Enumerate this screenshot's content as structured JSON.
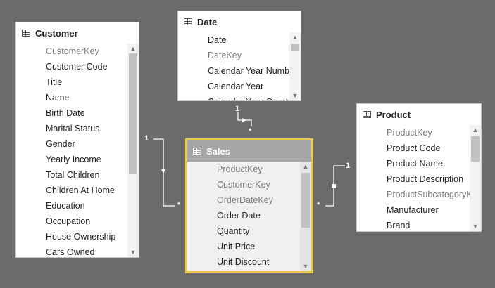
{
  "tables": {
    "customer": {
      "title": "Customer",
      "fields": [
        "CustomerKey",
        "Customer Code",
        "Title",
        "Name",
        "Birth Date",
        "Marital Status",
        "Gender",
        "Yearly Income",
        "Total Children",
        "Children At Home",
        "Education",
        "Occupation",
        "House Ownership",
        "Cars Owned"
      ],
      "key_fields": [
        0
      ]
    },
    "date": {
      "title": "Date",
      "fields": [
        "Date",
        "DateKey",
        "Calendar Year Numb",
        "Calendar Year",
        "Calendar Year Quart"
      ],
      "key_fields": [
        1
      ]
    },
    "sales": {
      "title": "Sales",
      "fields": [
        "ProductKey",
        "CustomerKey",
        "OrderDateKey",
        "Order Date",
        "Quantity",
        "Unit Price",
        "Unit Discount"
      ],
      "key_fields": [
        0,
        1,
        2
      ]
    },
    "product": {
      "title": "Product",
      "fields": [
        "ProductKey",
        "Product Code",
        "Product Name",
        "Product Description",
        "ProductSubcategoryKey",
        "Manufacturer",
        "Brand"
      ],
      "key_fields": [
        0,
        4
      ]
    }
  },
  "relationships": {
    "customer_sales": {
      "one": "1",
      "many": "*"
    },
    "date_sales": {
      "one": "1",
      "many": "*"
    },
    "product_sales": {
      "one": "1",
      "many": "*"
    }
  },
  "colors": {
    "canvas": "#6b6b6b",
    "selected_border": "#e8c94a",
    "selected_header": "#a6a6a6",
    "key_field_text": "#7a7a7a"
  }
}
